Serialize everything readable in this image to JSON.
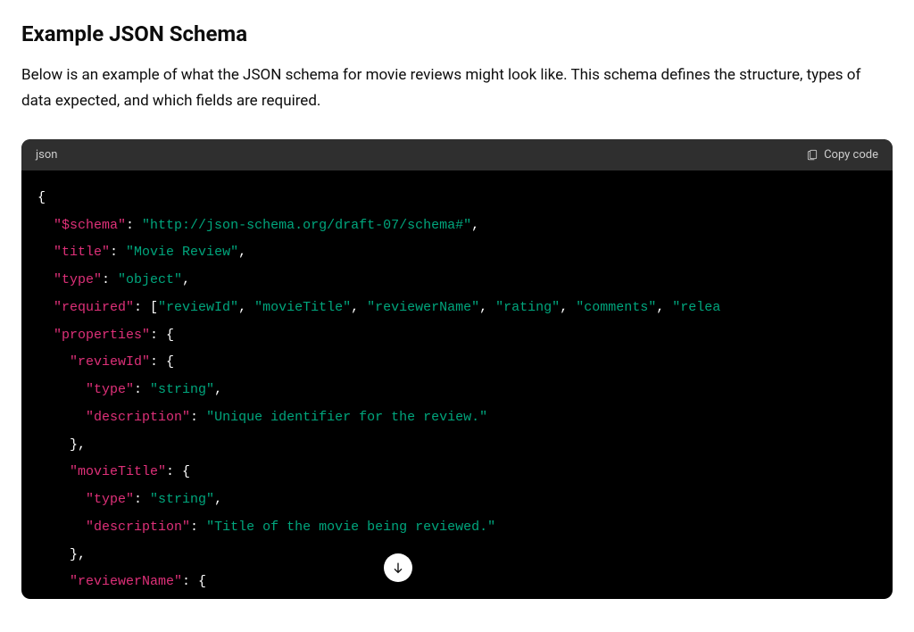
{
  "heading": "Example JSON Schema",
  "description": "Below is an example of what the JSON schema for movie reviews might look like. This schema defines the structure, types of data expected, and which fields are required.",
  "codeHeader": {
    "language": "json",
    "copyLabel": "Copy code"
  },
  "schema": {
    "keys": {
      "schema": "\"$schema\"",
      "title": "\"title\"",
      "type": "\"type\"",
      "required": "\"required\"",
      "properties": "\"properties\"",
      "reviewId": "\"reviewId\"",
      "movieTitle": "\"movieTitle\"",
      "reviewerName": "\"reviewerName\"",
      "description": "\"description\""
    },
    "values": {
      "schemaUrl": "\"http://json-schema.org/draft-07/schema#\"",
      "titleValue": "\"Movie Review\"",
      "typeObject": "\"object\"",
      "typeString": "\"string\"",
      "reviewIdDesc": "\"Unique identifier for the review.\"",
      "movieTitleDesc": "\"Title of the movie being reviewed.\""
    },
    "requiredArray": {
      "r0": "\"reviewId\"",
      "r1": "\"movieTitle\"",
      "r2": "\"reviewerName\"",
      "r3": "\"rating\"",
      "r4": "\"comments\"",
      "r5": "\"relea"
    }
  }
}
